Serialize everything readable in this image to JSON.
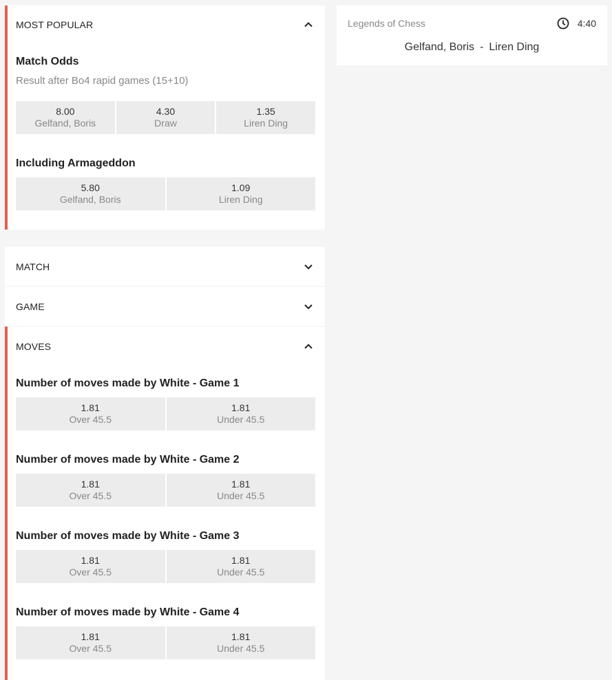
{
  "colors": {
    "accent": "#e4604a",
    "odds_bg": "#ececec",
    "page_bg": "#f5f5f5"
  },
  "event": {
    "league": "Legends of Chess",
    "clock_icon": "clock-icon",
    "time": "4:40",
    "home": "Gelfand, Boris",
    "separator": "-",
    "away": "Liren Ding"
  },
  "most_popular": {
    "header": "MOST POPULAR",
    "state": "expanded",
    "markets": [
      {
        "title": "Match Odds",
        "subtitle": "Result after Bo4 rapid games (15+10)",
        "odds": [
          {
            "price": "8.00",
            "label": "Gelfand, Boris"
          },
          {
            "price": "4.30",
            "label": "Draw"
          },
          {
            "price": "1.35",
            "label": "Liren Ding"
          }
        ]
      },
      {
        "title": "Including Armageddon",
        "odds": [
          {
            "price": "5.80",
            "label": "Gelfand, Boris"
          },
          {
            "price": "1.09",
            "label": "Liren Ding"
          }
        ]
      }
    ]
  },
  "sections": [
    {
      "header": "MATCH",
      "state": "collapsed"
    },
    {
      "header": "GAME",
      "state": "collapsed"
    },
    {
      "header": "MOVES",
      "state": "expanded",
      "markets": [
        {
          "title": "Number of moves made by White - Game 1",
          "odds": [
            {
              "price": "1.81",
              "label": "Over 45.5"
            },
            {
              "price": "1.81",
              "label": "Under 45.5"
            }
          ]
        },
        {
          "title": "Number of moves made by White - Game 2",
          "odds": [
            {
              "price": "1.81",
              "label": "Over 45.5"
            },
            {
              "price": "1.81",
              "label": "Under 45.5"
            }
          ]
        },
        {
          "title": "Number of moves made by White - Game 3",
          "odds": [
            {
              "price": "1.81",
              "label": "Over 45.5"
            },
            {
              "price": "1.81",
              "label": "Under 45.5"
            }
          ]
        },
        {
          "title": "Number of moves made by White - Game 4",
          "odds": [
            {
              "price": "1.81",
              "label": "Over 45.5"
            },
            {
              "price": "1.81",
              "label": "Under 45.5"
            }
          ]
        }
      ]
    }
  ]
}
